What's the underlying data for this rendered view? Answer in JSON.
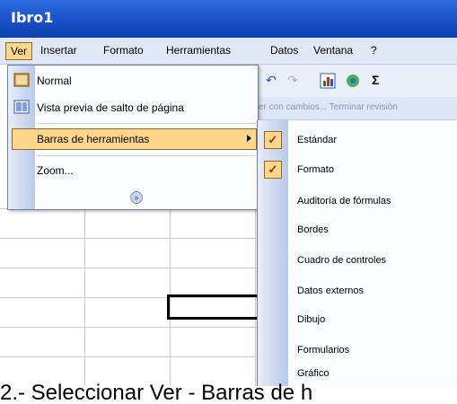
{
  "window": {
    "title": "Ibro1"
  },
  "menubar": {
    "items": [
      {
        "label": "Ver"
      },
      {
        "label": "Insertar"
      },
      {
        "label": "Formato"
      },
      {
        "label": "Herramientas"
      },
      {
        "label": "Datos"
      },
      {
        "label": "Ventana"
      },
      {
        "label": "?"
      }
    ]
  },
  "toolbar": {
    "buttons": [
      "undo-icon",
      "redo-icon",
      "chart-icon",
      "grid-icon",
      "sum-icon"
    ],
    "sum_label": "Σ",
    "row2_text": "er con cambios...   Terminar revisión"
  },
  "view_menu": {
    "items": [
      {
        "label": "Normal"
      },
      {
        "label": "Vista previa de salto de página"
      },
      {
        "label": "Barras de herramientas"
      },
      {
        "label": "Zoom..."
      }
    ],
    "expand_label": "»"
  },
  "toolbars_submenu": {
    "items": [
      {
        "label": "Estándar",
        "checked": true
      },
      {
        "label": "Formato",
        "checked": true
      },
      {
        "label": "Auditoría de fórmulas",
        "checked": false
      },
      {
        "label": "Bordes",
        "checked": false
      },
      {
        "label": "Cuadro de controles",
        "checked": false
      },
      {
        "label": "Datos externos",
        "checked": false
      },
      {
        "label": "Dibujo",
        "checked": false
      },
      {
        "label": "Formularios",
        "checked": false
      },
      {
        "label": "Gráfico",
        "checked": false
      }
    ],
    "check_mark": "✓"
  },
  "caption": {
    "text": "2.- Seleccionar Ver - Barras de h"
  },
  "colors": {
    "highlight": "#ffd68a",
    "titlebar": "#1c55cc",
    "menubar": "#dfe8f5"
  }
}
